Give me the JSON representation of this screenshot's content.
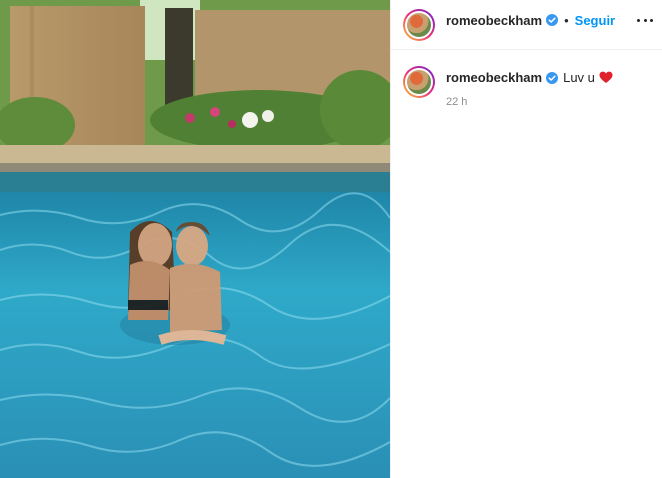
{
  "post": {
    "photo_alt": "",
    "icon_verified": "verified-badge-icon",
    "icon_heart": "heart-icon",
    "icon_more": "more-options-icon"
  },
  "header": {
    "username": "romeobeckham",
    "separator": "•",
    "follow_label": "Seguir"
  },
  "caption": {
    "username": "romeobeckham",
    "text": "Luv u",
    "emoji": "❤️",
    "time": "22 h"
  },
  "colors": {
    "accent": "#0095f6",
    "heart": "#e0202a",
    "verified": "#3897f0",
    "muted": "#8e8e8e"
  }
}
